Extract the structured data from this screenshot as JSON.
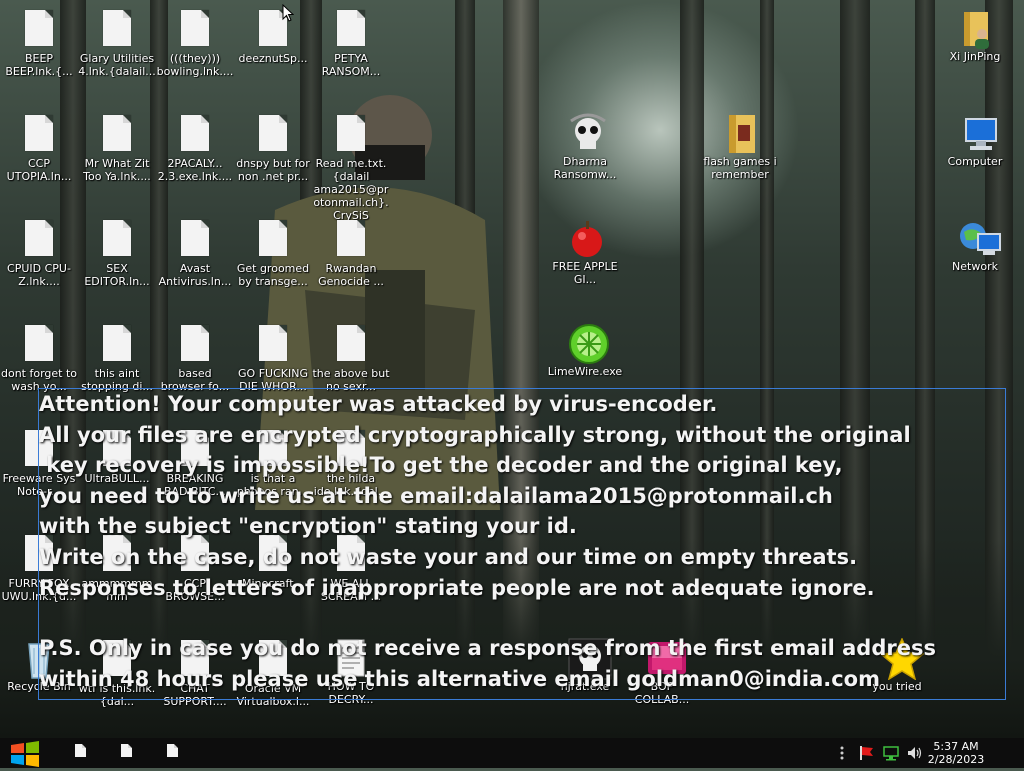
{
  "desktop": {
    "icons": [
      {
        "id": "beep",
        "label": "BEEP BEEP.lnk.{...",
        "type": "file"
      },
      {
        "id": "glary",
        "label": "Glary Utilities 4.lnk.{dalail...",
        "type": "file"
      },
      {
        "id": "bowling",
        "label": "(((they))) bowling.lnk....",
        "type": "file"
      },
      {
        "id": "deeznut",
        "label": "deeznutSp...",
        "type": "file"
      },
      {
        "id": "petya",
        "label": "PETYA RANSOM...",
        "type": "file"
      },
      {
        "id": "xijinping",
        "label": "Xi JinPing",
        "type": "user-folder"
      },
      {
        "id": "ccp",
        "label": "CCP UTOPIA.ln...",
        "type": "file"
      },
      {
        "id": "mrwhat",
        "label": "Mr What Zit Too Ya.lnk....",
        "type": "file"
      },
      {
        "id": "2pacaly",
        "label": "2PACALY... 2.3.exe.lnk....",
        "type": "file"
      },
      {
        "id": "dnspy",
        "label": "dnspy but for non .net pr...",
        "type": "file"
      },
      {
        "id": "readme",
        "label": "Read me.txt.{dalail ama2015@pr otonmail.ch}. CrySiS",
        "type": "file"
      },
      {
        "id": "dharma",
        "label": "Dharma Ransomw...",
        "type": "skull"
      },
      {
        "id": "flash",
        "label": "flash games i remember",
        "type": "folder"
      },
      {
        "id": "computer",
        "label": "Computer",
        "type": "computer"
      },
      {
        "id": "cpuid",
        "label": "CPUID CPU-Z.lnk....",
        "type": "file"
      },
      {
        "id": "sex",
        "label": "SEX EDITOR.ln...",
        "type": "file"
      },
      {
        "id": "avast",
        "label": "Avast Antivirus.ln...",
        "type": "file"
      },
      {
        "id": "groomed",
        "label": "Get groomed by transge...",
        "type": "file"
      },
      {
        "id": "rwandan",
        "label": "Rwandan Genocide ...",
        "type": "file"
      },
      {
        "id": "apple",
        "label": "FREE APPLE GI...",
        "type": "apple"
      },
      {
        "id": "network",
        "label": "Network",
        "type": "network"
      },
      {
        "id": "dontforget",
        "label": "dont forget to wash yo...",
        "type": "file"
      },
      {
        "id": "thisaint",
        "label": "this aint stopping di...",
        "type": "file"
      },
      {
        "id": "based",
        "label": "based browser fo...",
        "type": "file"
      },
      {
        "id": "gofucking",
        "label": "GO FUCKING DIE WHOR...",
        "type": "file"
      },
      {
        "id": "theabove",
        "label": "the above but no sexr...",
        "type": "file"
      },
      {
        "id": "limewire",
        "label": "LimeWire.exe",
        "type": "limewire"
      },
      {
        "id": "freeware",
        "label": "Freeware Sys Note-r...",
        "type": "file"
      },
      {
        "id": "ultrabull",
        "label": "UltraBULL...",
        "type": "file"
      },
      {
        "id": "breaking",
        "label": "BREAKING BAD BITC...",
        "type": "file"
      },
      {
        "id": "isthat",
        "label": "is that a phobos ran...",
        "type": "file"
      },
      {
        "id": "hilda",
        "label": "the hilda ide.lnk.{dal...",
        "type": "file"
      },
      {
        "id": "furry",
        "label": "FURRY FOX UWU.lnk.{d...",
        "type": "file"
      },
      {
        "id": "ammm",
        "label": "ammmmmmmm chrome.lnk....",
        "type": "file"
      },
      {
        "id": "ccpbrowse",
        "label": "CCP BROWSE...",
        "type": "file"
      },
      {
        "id": "minecraft",
        "label": "Minecraft...",
        "type": "file"
      },
      {
        "id": "weall",
        "label": "WE ALL SCREAM ...",
        "type": "file"
      },
      {
        "id": "recycle",
        "label": "Recycle Bin",
        "type": "recycle"
      },
      {
        "id": "wtf",
        "label": "wtf is this.lnk.{dal...",
        "type": "file"
      },
      {
        "id": "chat",
        "label": "CHAT SUPPORT....",
        "type": "file"
      },
      {
        "id": "oracle",
        "label": "Oracle VM Virtualbox.l...",
        "type": "file"
      },
      {
        "id": "howto",
        "label": "HOW TO DECRY...",
        "type": "textfile"
      },
      {
        "id": "njrat",
        "label": "njrat.exe",
        "type": "skull2"
      },
      {
        "id": "bop",
        "label": "BOP COLLAB...",
        "type": "media"
      },
      {
        "id": "youtried",
        "label": "you tried",
        "type": "star"
      }
    ]
  },
  "ransom_note": {
    "lines": [
      "Attention! Your computer was attacked by virus-encoder.",
      "All your files are encrypted cryptographically strong, without the original",
      " key recovery is impossible!To get the decoder and the original key,",
      "you need to to write us at the email:dalailama2015@protonmail.ch",
      "with the subject \"encryption\" stating your id.",
      "Write on the case, do not waste your and our time on empty threats.",
      "Responses to letters of inappropriate people are not adequate ignore.",
      "",
      "P.S. Only in case you do not receive a response from the first email address",
      "within 48 hours please use this alternative email goldman0@india.com"
    ]
  },
  "taskbar": {
    "time": "5:37 AM",
    "date": "2/28/2023",
    "colors": {
      "start_red": "#f25022",
      "start_green": "#7fba00",
      "start_blue": "#00a4ef",
      "start_yellow": "#ffb900"
    }
  }
}
